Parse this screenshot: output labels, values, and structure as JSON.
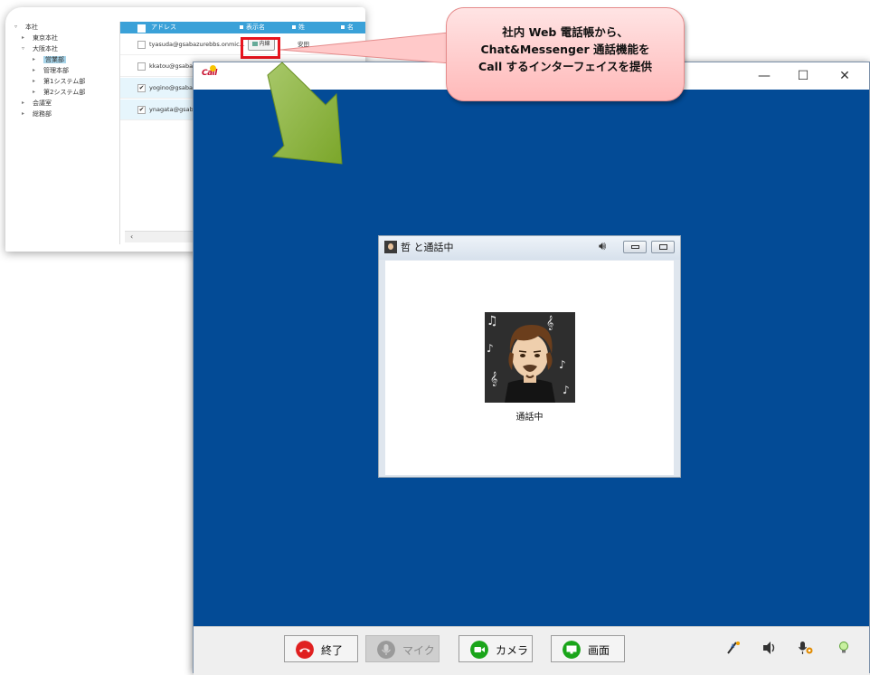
{
  "phonebook": {
    "tree": [
      {
        "label": "本社",
        "level": 0,
        "selected": false
      },
      {
        "label": "東京本社",
        "level": 1,
        "selected": false
      },
      {
        "label": "大阪本社",
        "level": 1,
        "selected": false
      },
      {
        "label": "営業部",
        "level": 2,
        "selected": true
      },
      {
        "label": "管理本部",
        "level": 2,
        "selected": false
      },
      {
        "label": "第1システム部",
        "level": 2,
        "selected": false
      },
      {
        "label": "第2システム部",
        "level": 2,
        "selected": false
      },
      {
        "label": "会議室",
        "level": 1,
        "selected": false
      },
      {
        "label": "総務部",
        "level": 1,
        "selected": false
      }
    ],
    "columns": {
      "address": "アドレス",
      "display_name": "表示名",
      "surname": "姓",
      "name": "名"
    },
    "rows": [
      {
        "email": "tyasuda@gsabazurebbs.onmic...",
        "checked": false,
        "naisen": "内線",
        "surname": "安田"
      },
      {
        "email": "kkatou@gsaba",
        "checked": false
      },
      {
        "email": "yogino@gsaba",
        "checked": true
      },
      {
        "email": "ynagata@gsab",
        "checked": true
      }
    ],
    "scroll_left": "‹"
  },
  "callout": {
    "line1": "社内 Web 電話帳から、",
    "line2": "Chat&Messenger 通話機能を",
    "line3": "Call するインターフェイスを提供"
  },
  "call_window": {
    "app_logo": "Call",
    "controls": {
      "minimize": "—",
      "maximize": "☐",
      "close": "✕"
    },
    "inner": {
      "title": "哲 と通話中",
      "status": "通話中"
    },
    "toolbar": {
      "end_label": "終了",
      "mic_label": "マイク",
      "camera_label": "カメラ",
      "screen_label": "画面"
    }
  },
  "colors": {
    "call_bg": "#034b96",
    "header_blue": "#3aa1d8",
    "highlight_red": "#e8141e",
    "end_red": "#e02020",
    "camera_green": "#1aa51a",
    "arrow_green": "#8db33a"
  }
}
